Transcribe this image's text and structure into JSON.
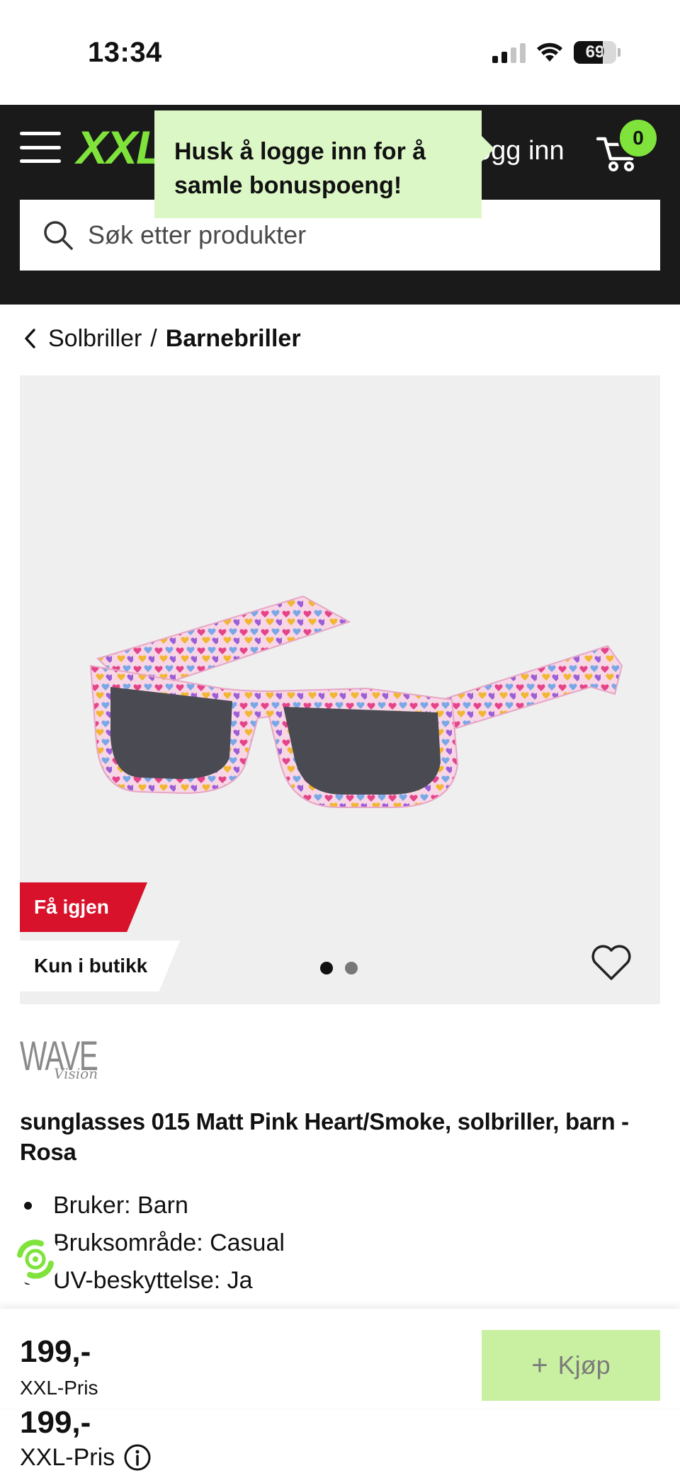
{
  "status_bar": {
    "time": "13:34",
    "battery": "69",
    "battery_level": 0.69
  },
  "header": {
    "logo": "XXL",
    "login_label": "ogg inn",
    "cart_count": "0",
    "tooltip": "Husk å logge inn for å samle bonuspoeng!",
    "search_placeholder": "Søk etter produkter"
  },
  "breadcrumb": {
    "parent": "Solbriller",
    "separator": "/",
    "current": "Barnebriller"
  },
  "gallery": {
    "badges": [
      "Få igjen",
      "Kun i butikk"
    ],
    "image_count": 2,
    "active_image": 1
  },
  "product": {
    "brand_main": "WAVE",
    "brand_sub": "Vision",
    "title": "sunglasses 015 Matt Pink Heart/Smoke, solbriller, barn - Rosa",
    "specs": [
      "Bruker: Barn",
      "Bruksområde: Casual",
      "UV-beskyttelse: Ja"
    ]
  },
  "buy_bar": {
    "price": "199,-",
    "price_label": "XXL-Pris",
    "buy_label": "Kjøp"
  },
  "underlay": {
    "price": "199,-",
    "price_label": "XXL-Pris"
  },
  "colors": {
    "accent": "#7fe33c",
    "header_bg": "#1a1a1a",
    "badge_red": "#d9122c",
    "tooltip_bg": "#dcf7c6",
    "buy_button": "#c9f0a1"
  },
  "icons": [
    "hamburger-icon",
    "cart-icon",
    "search-icon",
    "chevron-left-icon",
    "heart-icon",
    "info-icon",
    "plus-icon"
  ]
}
